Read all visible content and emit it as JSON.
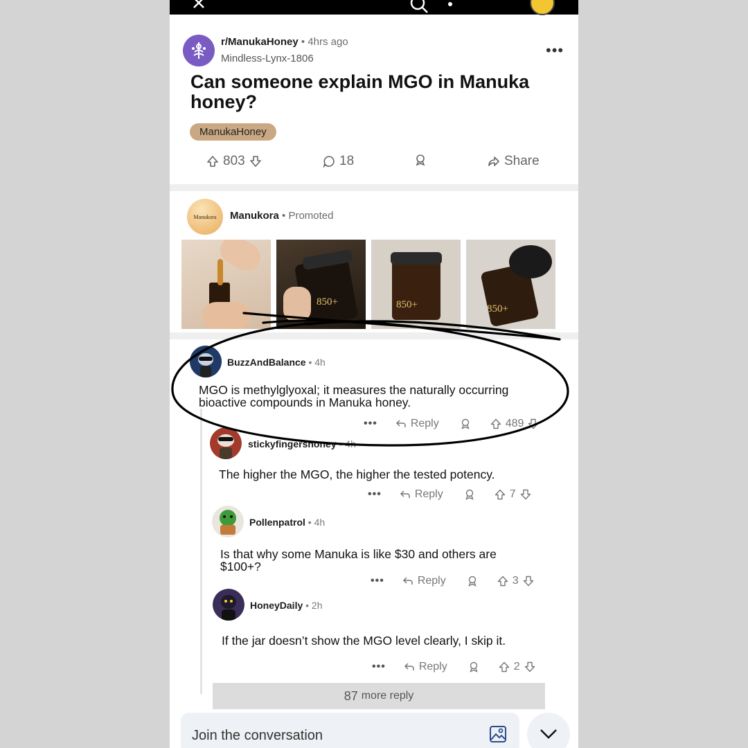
{
  "post": {
    "subreddit": "r/ManukaHoney",
    "time": "• 4hrs ago",
    "author": "Mindless-Lynx-1806",
    "title": "Can someone explain MGO in Manuka honey?",
    "flair": "ManukaHoney",
    "upvotes": "803",
    "comments": "18",
    "share": "Share",
    "menu": "•••"
  },
  "ad": {
    "brand": "Manukora",
    "promoted": "• Promoted",
    "avatar_text": "Manukora",
    "jar_label": "850+"
  },
  "comments": [
    {
      "user": "BuzzAndBalance",
      "time": "• 4h",
      "text": "MGO is methylglyoxal; it measures the naturally occurring bioactive compounds in Manuka honey.",
      "score": "489",
      "reply": "Reply",
      "dots": "•••"
    },
    {
      "user": "stickyfingershoney",
      "time": "• 4h",
      "text": "The higher the MGO, the higher the tested potency.",
      "score": "7",
      "reply": "Reply",
      "dots": "•••"
    },
    {
      "user": "Pollenpatrol",
      "time": "• 4h",
      "text": "Is that why some Manuka is like $30 and others are $100+?",
      "score": "3",
      "reply": "Reply",
      "dots": "•••"
    },
    {
      "user": "HoneyDaily",
      "time": "• 2h",
      "text": "If the jar doesn’t show the MGO level clearly, I skip it.",
      "score": "2",
      "reply": "Reply",
      "dots": "•••"
    }
  ],
  "more_replies": {
    "count": "87",
    "label": "more reply"
  },
  "composer": {
    "placeholder": "Join the conversation"
  },
  "colors": {
    "flair": "#c9a883",
    "subreddit_avatar": "#7a5bc4",
    "annotation_ink": "#000000"
  }
}
